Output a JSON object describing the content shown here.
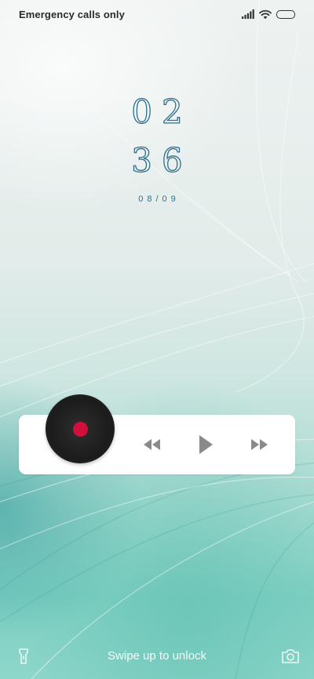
{
  "status_bar": {
    "carrier_text": "Emergency calls only",
    "icons": [
      "signal-icon",
      "wifi-icon",
      "battery-icon"
    ]
  },
  "lockscreen": {
    "clock_hours": "02",
    "clock_minutes": "36",
    "date": "08/09"
  },
  "music_player": {
    "album_art_icon": "vinyl-record-icon",
    "controls": [
      "previous-icon",
      "play-icon",
      "next-icon"
    ],
    "accent_color": "#d0103a"
  },
  "bottom_bar": {
    "unlock_hint": "Swipe up to unlock",
    "left_shortcut_icon": "flashlight-icon",
    "right_shortcut_icon": "camera-icon"
  },
  "colors": {
    "clock": "#2f6f8d",
    "card_background": "#ffffff",
    "control_icons": "#8a8a8a"
  }
}
